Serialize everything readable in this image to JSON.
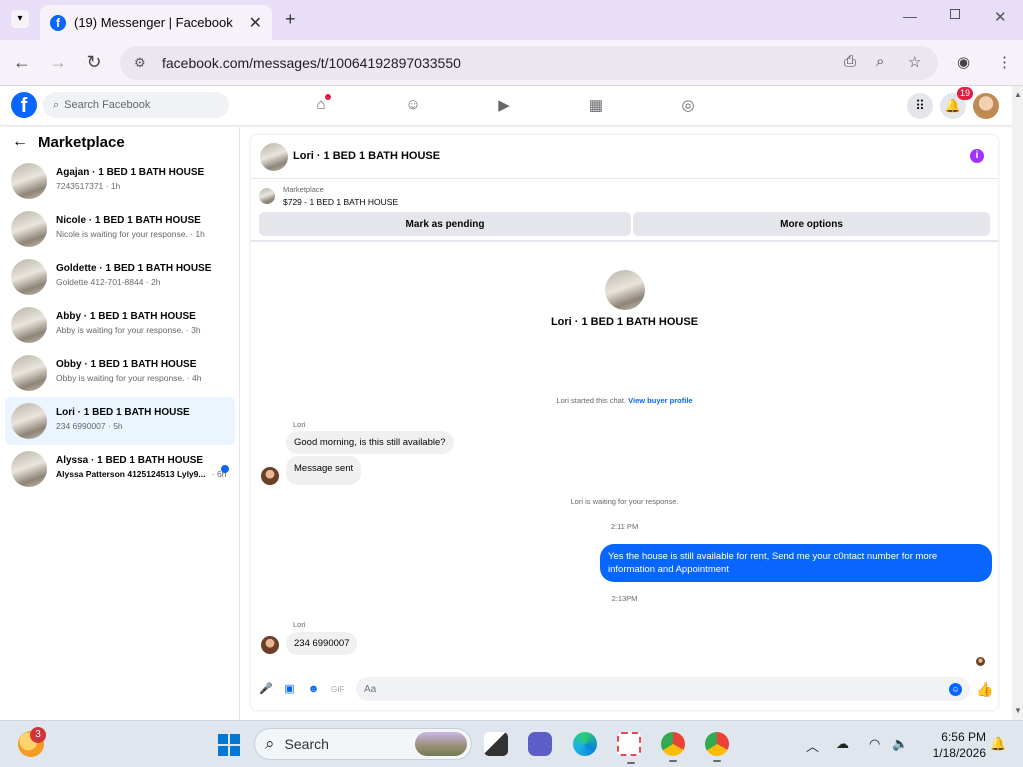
{
  "browser": {
    "tab_title": "(19) Messenger | Facebook",
    "url": "facebook.com/messages/t/10064192897033550"
  },
  "header": {
    "search_placeholder": "Search Facebook",
    "notifications_count": "19"
  },
  "sidebar": {
    "title": "Marketplace",
    "conversations": [
      {
        "name": "Agajan · 1 BED 1 BATH HOUSE",
        "preview": "7243517371 · 1h",
        "unread": false,
        "active": false
      },
      {
        "name": "Nicole · 1 BED 1 BATH HOUSE",
        "preview": "Nicole is waiting for your response. · 1h",
        "unread": false,
        "active": false
      },
      {
        "name": "Goldette · 1 BED 1 BATH HOUSE",
        "preview": "Goldette 412-701-8844 · 2h",
        "unread": false,
        "active": false
      },
      {
        "name": "Abby · 1 BED 1 BATH HOUSE",
        "preview": "Abby is waiting for your response. · 3h",
        "unread": false,
        "active": false
      },
      {
        "name": "Obby · 1 BED 1 BATH HOUSE",
        "preview": "Obby is waiting for your response. · 4h",
        "unread": false,
        "active": false
      },
      {
        "name": "Lori · 1 BED 1 BATH HOUSE",
        "preview": "234 6990007 · 5h",
        "unread": false,
        "active": true
      },
      {
        "name": "Alyssa · 1 BED 1 BATH HOUSE",
        "preview": "Alyssa Patterson 4125124513 Lyly9...",
        "time": "· 6h",
        "unread": true,
        "active": false
      }
    ]
  },
  "chat": {
    "title": "Lori · 1 BED 1 BATH HOUSE",
    "listing_source": "Marketplace",
    "listing_price_title": "$729 - 1 BED 1 BATH HOUSE",
    "mark_pending_label": "Mark as pending",
    "more_options_label": "More options",
    "intro_name": "Lori · 1 BED 1 BATH HOUSE",
    "started_text": "Lori started this chat.",
    "view_buyer_label": "View buyer profile",
    "sender_name_1": "Lori",
    "msg_in_1": "Good morning, is this still available?",
    "msg_in_2": "Message sent",
    "waiting_text": "Lori is waiting for your response.",
    "time_1": "2:11 PM",
    "msg_out_1": "Yes the house is still available for rent, Send me your c0ntact number for more information and Appointment",
    "time_2": "2:13PM",
    "sender_name_2": "Lori",
    "msg_in_3": "234 6990007",
    "composer_placeholder": "Aa"
  },
  "taskbar": {
    "weather_badge": "3",
    "search_label": "Search",
    "time": "6:56 PM",
    "date": "1/18/2026"
  },
  "colors": {
    "facebook_blue": "#0866ff",
    "active_conversation": "#ebf5ff",
    "notification_red": "#e41e3f",
    "info_purple": "#a033ff"
  }
}
